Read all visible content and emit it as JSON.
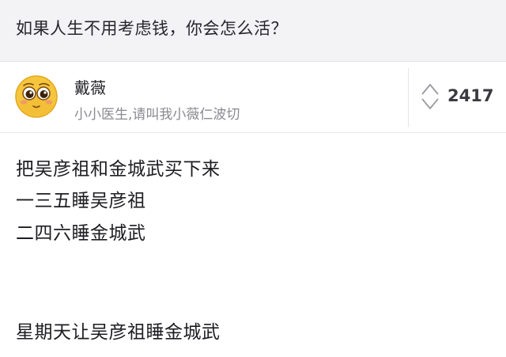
{
  "question": {
    "title": "如果人生不用考虑钱，你会怎么活？"
  },
  "author": {
    "name": "戴薇",
    "bio": "小小医生,请叫我小薇仁波切",
    "avatar_icon": "smiley-face-avatar"
  },
  "vote": {
    "count": "2417",
    "icon": "up-down-arrows-icon"
  },
  "answer": {
    "lines": [
      "把吴彦祖和金城武买下来",
      "一三五睡吴彦祖",
      "二四六睡金城武",
      "",
      "星期天让吴彦祖睡金城武"
    ]
  }
}
